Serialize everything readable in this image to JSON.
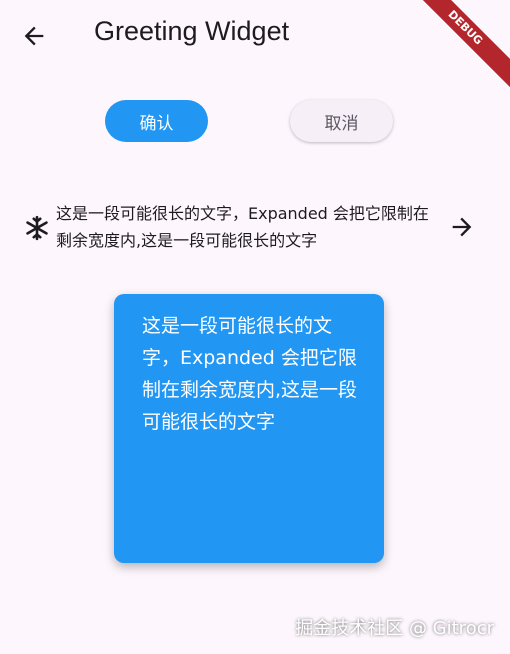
{
  "appbar": {
    "title": "Greeting Widget",
    "back_icon": "arrow-back-icon",
    "debug_label": "DEBUG"
  },
  "buttons": {
    "confirm_label": "确认",
    "cancel_label": "取消"
  },
  "row": {
    "leading_icon": "snowflake-icon",
    "text": "这是一段可能很长的文字，Expanded 会把它限制在剩余宽度内,这是一段可能很长的文字",
    "trailing_icon": "arrow-forward-icon"
  },
  "card": {
    "text": "这是一段可能很长的文字，Expanded 会把它限制在剩余宽度内,这是一段可能很长的文字"
  },
  "watermark": "掘金技术社区 @ Gitrocr",
  "colors": {
    "background": "#fdf7fd",
    "primary": "#2196f3",
    "debug_ribbon": "#b3262c"
  }
}
